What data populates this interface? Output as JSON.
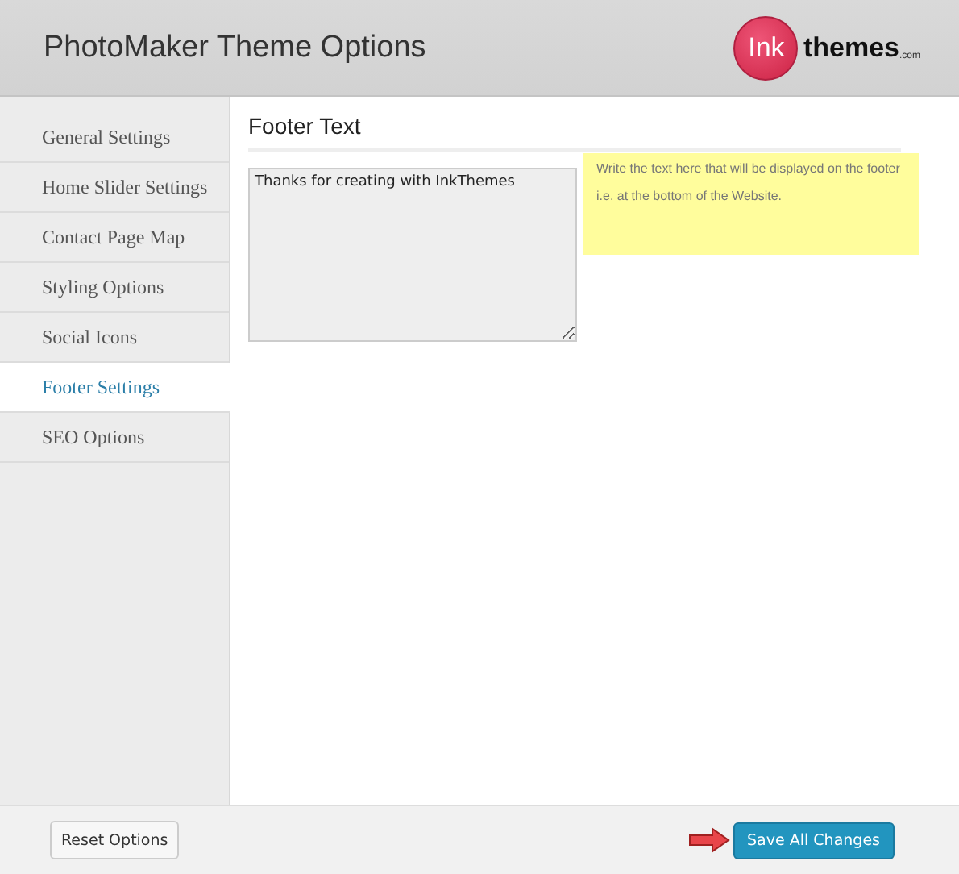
{
  "header": {
    "title": "PhotoMaker Theme Options",
    "logo": {
      "mark": "Ink",
      "word": "themes",
      "suffix": ".com"
    }
  },
  "sidebar": {
    "items": [
      {
        "label": "General Settings",
        "selected": false
      },
      {
        "label": "Home Slider Settings",
        "selected": false
      },
      {
        "label": "Contact Page Map",
        "selected": false
      },
      {
        "label": "Styling Options",
        "selected": false
      },
      {
        "label": "Social Icons",
        "selected": false
      },
      {
        "label": "Footer Settings",
        "selected": true
      },
      {
        "label": "SEO Options",
        "selected": false
      }
    ]
  },
  "section": {
    "title": "Footer Text",
    "field": {
      "value": "Thanks for creating with InkThemes"
    },
    "help": "Write the text here that will be displayed on the footer i.e. at the bottom of the Website."
  },
  "footer": {
    "reset": "Reset Options",
    "save": "Save All Changes"
  }
}
